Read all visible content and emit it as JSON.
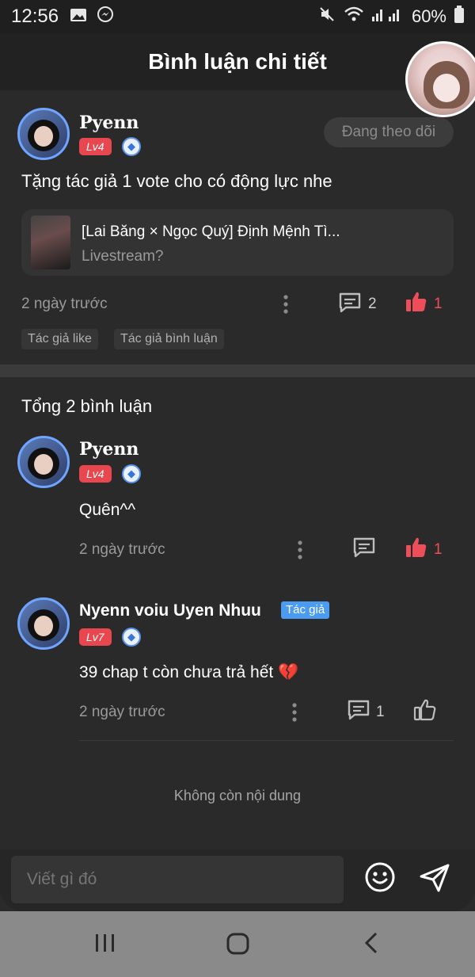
{
  "status_bar": {
    "time": "12:56",
    "battery": "60%"
  },
  "header": {
    "title": "Bình luận chi tiết"
  },
  "post": {
    "username": "Pyenn",
    "level": "Lv4",
    "follow_label": "Đang theo dõi",
    "text": "Tặng tác giả 1 vote cho có động lực nhe",
    "story_title": "[Lai Băng × Ngọc Quý] Định Mệnh Tì...",
    "story_chapter": "Livestream?",
    "time": "2 ngày trước",
    "comment_count": "2",
    "like_count": "1",
    "tags": [
      "Tác giả like",
      "Tác giả bình luận"
    ]
  },
  "replies": {
    "total_label": "Tổng 2 bình luận",
    "items": [
      {
        "username": "Pyenn",
        "level": "Lv4",
        "text": "Quên^^",
        "time": "2 ngày trước",
        "comment_count": "",
        "like_count": "1"
      },
      {
        "username": "Nyenn voiu Uyen Nhuu",
        "author_tag": "Tác giả",
        "level": "Lv7",
        "text": "39 chap t còn chưa trả hết 💔",
        "time": "2 ngày trước",
        "comment_count": "1",
        "like_count": ""
      }
    ],
    "end_label": "Không còn nội dung"
  },
  "input": {
    "placeholder": "Viết gì đó"
  },
  "colors": {
    "like_red": "#ee4d5a",
    "level_badge": "#e8474f",
    "author_tag": "#4b9cf0"
  },
  "icons": [
    "image-icon",
    "messenger-icon",
    "mute-icon",
    "wifi-icon",
    "signal-icon",
    "battery-icon",
    "comment-icon",
    "thumbs-up-icon",
    "more-vertical-icon",
    "emoji-icon",
    "send-icon",
    "recent-apps-icon",
    "home-icon",
    "back-icon"
  ]
}
